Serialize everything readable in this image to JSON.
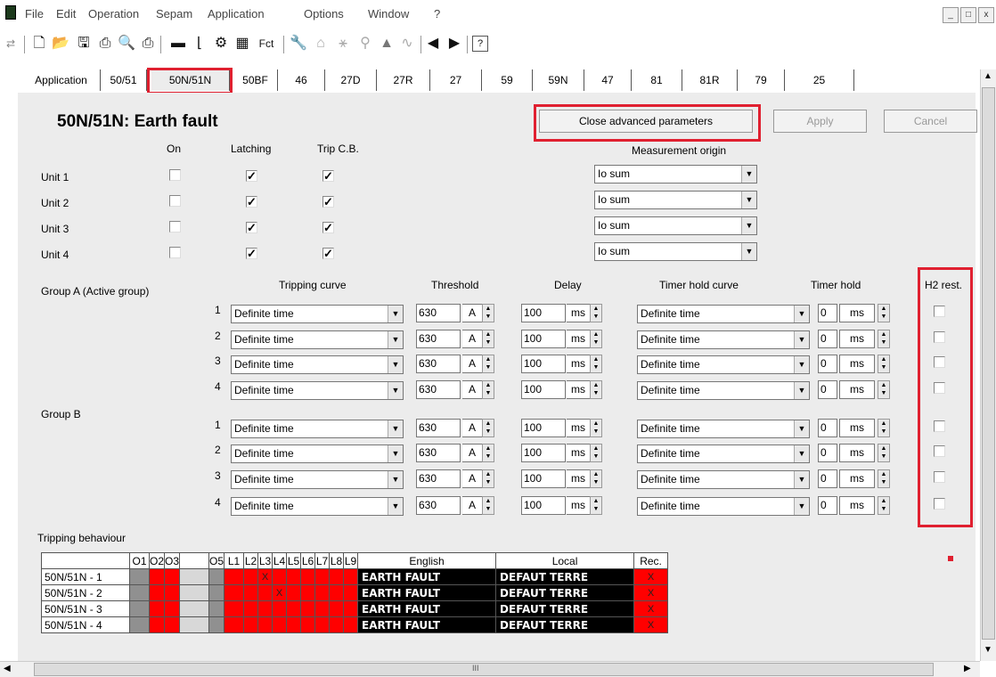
{
  "menu": [
    "File",
    "Edit",
    "Operation",
    "Sepam",
    "Application",
    "Options",
    "Window",
    "?"
  ],
  "window_buttons": [
    "_",
    "□",
    "x"
  ],
  "toolbar": {
    "fct_label": "Fct"
  },
  "tabs": [
    "Application",
    "50/51",
    "50N/51N",
    "50BF",
    "46",
    "27D",
    "27R",
    "27",
    "59",
    "59N",
    "47",
    "81",
    "81R",
    "79",
    "25"
  ],
  "active_tab": "50N/51N",
  "title": "50N/51N: Earth fault",
  "buttons": {
    "close_adv": "Close advanced parameters",
    "apply": "Apply",
    "cancel": "Cancel"
  },
  "col_headers": {
    "on": "On",
    "latching": "Latching",
    "trip": "Trip C.B.",
    "meas": "Measurement origin"
  },
  "units": [
    {
      "label": "Unit 1",
      "on": false,
      "latching": true,
      "trip": true,
      "meas": "Io sum"
    },
    {
      "label": "Unit 2",
      "on": false,
      "latching": true,
      "trip": true,
      "meas": "Io sum"
    },
    {
      "label": "Unit 3",
      "on": false,
      "latching": true,
      "trip": true,
      "meas": "Io sum"
    },
    {
      "label": "Unit 4",
      "on": false,
      "latching": true,
      "trip": true,
      "meas": "Io sum"
    }
  ],
  "group_headers": {
    "group_a": "Group A  (Active group)",
    "group_b": "Group B",
    "curve": "Tripping curve",
    "threshold": "Threshold",
    "delay": "Delay",
    "thc": "Timer hold curve",
    "th": "Timer hold",
    "h2": "H2 rest."
  },
  "rows": [
    {
      "n": "1",
      "curve": "Definite time",
      "thr": "630",
      "thr_u": "A",
      "delay": "100",
      "delay_u": "ms",
      "thc": "Definite time",
      "th": "0",
      "th_u": "ms"
    },
    {
      "n": "2",
      "curve": "Definite time",
      "thr": "630",
      "thr_u": "A",
      "delay": "100",
      "delay_u": "ms",
      "thc": "Definite time",
      "th": "0",
      "th_u": "ms"
    },
    {
      "n": "3",
      "curve": "Definite time",
      "thr": "630",
      "thr_u": "A",
      "delay": "100",
      "delay_u": "ms",
      "thc": "Definite time",
      "th": "0",
      "th_u": "ms"
    },
    {
      "n": "4",
      "curve": "Definite time",
      "thr": "630",
      "thr_u": "A",
      "delay": "100",
      "delay_u": "ms",
      "thc": "Definite time",
      "th": "0",
      "th_u": "ms"
    },
    {
      "n": "1",
      "curve": "Definite time",
      "thr": "630",
      "thr_u": "A",
      "delay": "100",
      "delay_u": "ms",
      "thc": "Definite time",
      "th": "0",
      "th_u": "ms"
    },
    {
      "n": "2",
      "curve": "Definite time",
      "thr": "630",
      "thr_u": "A",
      "delay": "100",
      "delay_u": "ms",
      "thc": "Definite time",
      "th": "0",
      "th_u": "ms"
    },
    {
      "n": "3",
      "curve": "Definite time",
      "thr": "630",
      "thr_u": "A",
      "delay": "100",
      "delay_u": "ms",
      "thc": "Definite time",
      "th": "0",
      "th_u": "ms"
    },
    {
      "n": "4",
      "curve": "Definite time",
      "thr": "630",
      "thr_u": "A",
      "delay": "100",
      "delay_u": "ms",
      "thc": "Definite time",
      "th": "0",
      "th_u": "ms"
    }
  ],
  "tripping_behaviour": {
    "label": "Tripping behaviour",
    "headers": [
      "O1",
      "O2",
      "O3",
      "",
      "O5",
      "L1",
      "L2",
      "L3",
      "L4",
      "L5",
      "L6",
      "L7",
      "L8",
      "L9",
      "English",
      "Local",
      "Rec."
    ],
    "rows": [
      {
        "name": "50N/51N - 1",
        "marks": [
          "",
          "",
          "",
          "",
          "",
          "",
          "",
          "X",
          "",
          "",
          "",
          "",
          "",
          ""
        ],
        "english": "EARTH FAULT",
        "local": "DEFAUT TERRE",
        "rec": "X"
      },
      {
        "name": "50N/51N - 2",
        "marks": [
          "",
          "",
          "",
          "",
          "",
          "",
          "",
          "",
          "X",
          "",
          "",
          "",
          "",
          ""
        ],
        "english": "EARTH FAULT",
        "local": "DEFAUT TERRE",
        "rec": "X"
      },
      {
        "name": "50N/51N - 3",
        "marks": [
          "",
          "",
          "",
          "",
          "",
          "",
          "",
          "",
          "",
          "",
          "",
          "",
          "",
          ""
        ],
        "english": "EARTH FAULT",
        "local": "DEFAUT TERRE",
        "rec": "X"
      },
      {
        "name": "50N/51N - 4",
        "marks": [
          "",
          "",
          "",
          "",
          "",
          "",
          "",
          "",
          "",
          "",
          "",
          "",
          "",
          ""
        ],
        "english": "EARTH FAULT",
        "local": "DEFAUT TERRE",
        "rec": "X"
      }
    ]
  },
  "scroll_mark": "III",
  "colors": {
    "highlight": "#e02030",
    "red_cell": "#ff0000",
    "panel": "#ececec"
  }
}
